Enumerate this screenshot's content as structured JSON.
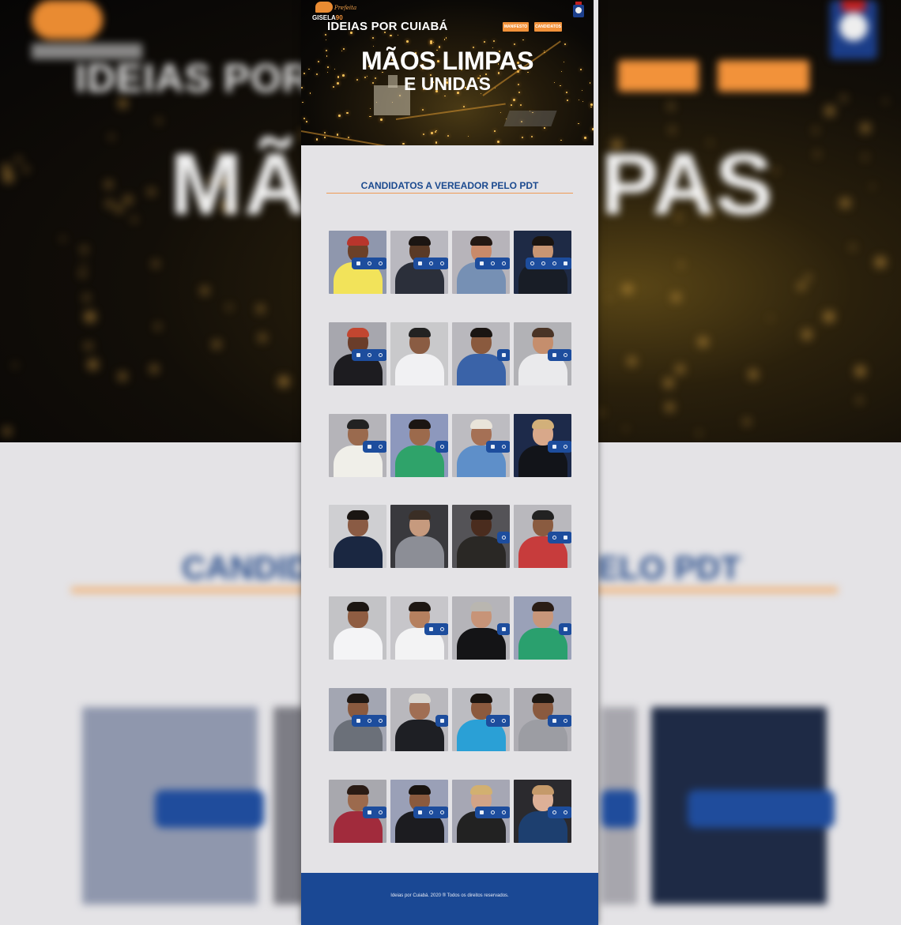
{
  "site": {
    "logo_name": "GISELA90",
    "logo_script": "Prefeita",
    "title": "IDEIAS POR CUIABÁ"
  },
  "nav": {
    "manifesto": "MANIFESTO",
    "candidatos": "CANDIDATOS"
  },
  "hero": {
    "line1": "MÃOS LIMPAS",
    "line2": "E UNIDAS"
  },
  "section": {
    "title": "CANDIDATOS A VEREADOR PELO PDT"
  },
  "candidates": [
    {
      "row": 0,
      "col": 0,
      "bg": "#8f97ad",
      "skin": "#6b4028",
      "outfit": "#f2e35a",
      "hair": "#b8352c",
      "icons": [
        "facebook-icon",
        "instagram-icon",
        "whatsapp-icon"
      ]
    },
    {
      "row": 0,
      "col": 1,
      "bg": "#b9b8bf",
      "skin": "#5a3a26",
      "outfit": "#2b2f3a",
      "hair": "#1b1512",
      "icons": [
        "facebook-icon",
        "instagram-icon",
        "whatsapp-icon"
      ]
    },
    {
      "row": 0,
      "col": 2,
      "bg": "#b7b4ba",
      "skin": "#c98a6a",
      "outfit": "#7690b4",
      "hair": "#231813",
      "icons": [
        "facebook-icon",
        "instagram-icon",
        "whatsapp-icon"
      ]
    },
    {
      "row": 0,
      "col": 3,
      "bg": "#1e2a45",
      "skin": "#c79573",
      "outfit": "#181d26",
      "hair": "#1a1410",
      "icons": [
        "instagram-icon",
        "twitter-icon",
        "whatsapp-icon",
        "facebook-icon"
      ]
    },
    {
      "row": 1,
      "col": 0,
      "bg": "#a7a7ae",
      "skin": "#6a3d2a",
      "outfit": "#1d1c20",
      "hair": "#c24630",
      "icons": [
        "facebook-icon",
        "instagram-icon",
        "whatsapp-icon"
      ]
    },
    {
      "row": 1,
      "col": 1,
      "bg": "#c9c9cb",
      "skin": "#8a5c43",
      "outfit": "#f1f1f3",
      "hair": "#222",
      "icons": []
    },
    {
      "row": 1,
      "col": 2,
      "bg": "#b9b8bd",
      "skin": "#8a5a3e",
      "outfit": "#3a63a8",
      "hair": "#1a1512",
      "icons": [
        "facebook-icon"
      ]
    },
    {
      "row": 1,
      "col": 3,
      "bg": "#b2b2b6",
      "skin": "#c58e6d",
      "outfit": "#eaeaec",
      "hair": "#4a3426",
      "icons": [
        "facebook-icon",
        "instagram-icon"
      ]
    },
    {
      "row": 2,
      "col": 0,
      "bg": "#b5b4b9",
      "skin": "#9a6a4e",
      "outfit": "#f0efe9",
      "hair": "#222",
      "icons": [
        "facebook-icon",
        "instagram-icon"
      ]
    },
    {
      "row": 2,
      "col": 1,
      "bg": "#8d98bd",
      "skin": "#9c6a4c",
      "outfit": "#2fa36a",
      "hair": "#1b1512",
      "icons": [
        "instagram-icon"
      ]
    },
    {
      "row": 2,
      "col": 2,
      "bg": "#bdbcc1",
      "skin": "#a57055",
      "outfit": "#5e8fc9",
      "hair": "#e9e4da",
      "icons": [
        "facebook-icon",
        "instagram-icon"
      ]
    },
    {
      "row": 2,
      "col": 3,
      "bg": "#1d2a4a",
      "skin": "#d8a88a",
      "outfit": "#121419",
      "hair": "#d2b07a",
      "icons": [
        "facebook-icon",
        "instagram-icon"
      ]
    },
    {
      "row": 3,
      "col": 0,
      "bg": "#cfcfd2",
      "skin": "#8a5b44",
      "outfit": "#1a2741",
      "hair": "#1a1512",
      "icons": []
    },
    {
      "row": 3,
      "col": 1,
      "bg": "#39393d",
      "skin": "#c69a7e",
      "outfit": "#8c8e96",
      "hair": "#3a2e25",
      "icons": []
    },
    {
      "row": 3,
      "col": 2,
      "bg": "#545357",
      "skin": "#4a2c1e",
      "outfit": "#2a2825",
      "hair": "#1a1512",
      "icons": [
        "whatsapp-icon"
      ]
    },
    {
      "row": 3,
      "col": 3,
      "bg": "#b9b8bd",
      "skin": "#8a5b40",
      "outfit": "#c73c3c",
      "hair": "#222",
      "icons": [
        "whatsapp-icon",
        "facebook-icon"
      ]
    },
    {
      "row": 4,
      "col": 0,
      "bg": "#c3c3c6",
      "skin": "#8f5d42",
      "outfit": "#f4f4f6",
      "hair": "#1c1612",
      "icons": []
    },
    {
      "row": 4,
      "col": 1,
      "bg": "#c7c6ca",
      "skin": "#b5805f",
      "outfit": "#f3f3f4",
      "hair": "#1e1713",
      "icons": [
        "facebook-icon",
        "instagram-icon"
      ]
    },
    {
      "row": 4,
      "col": 2,
      "bg": "#b5b4b9",
      "skin": "#c79478",
      "outfit": "#141416",
      "hair": "#b9b6b0",
      "icons": [
        "facebook-icon"
      ]
    },
    {
      "row": 4,
      "col": 3,
      "bg": "#9aa1b8",
      "skin": "#c8967a",
      "outfit": "#2aa06e",
      "hair": "#2a1d16",
      "icons": [
        "facebook-icon"
      ]
    },
    {
      "row": 5,
      "col": 0,
      "bg": "#a3a6b2",
      "skin": "#8a5a3f",
      "outfit": "#6b7079",
      "hair": "#1d1713",
      "icons": [
        "facebook-icon",
        "instagram-icon",
        "whatsapp-icon"
      ]
    },
    {
      "row": 5,
      "col": 1,
      "bg": "#b9b8bd",
      "skin": "#a06e53",
      "outfit": "#1e1f24",
      "hair": "#d9d7d2",
      "icons": [
        "facebook-icon"
      ]
    },
    {
      "row": 5,
      "col": 2,
      "bg": "#bcbcc1",
      "skin": "#8c5a3e",
      "outfit": "#2aa0d6",
      "hair": "#1a1410",
      "icons": [
        "instagram-icon",
        "whatsapp-icon"
      ]
    },
    {
      "row": 5,
      "col": 3,
      "bg": "#aeadb3",
      "skin": "#8a5a3f",
      "outfit": "#9c9da3",
      "hair": "#1c1713",
      "icons": [
        "facebook-icon",
        "instagram-icon"
      ]
    },
    {
      "row": 6,
      "col": 0,
      "bg": "#a8a8ae",
      "skin": "#9c6a4d",
      "outfit": "#a12b3c",
      "hair": "#2a1b14",
      "icons": [
        "facebook-icon",
        "instagram-icon"
      ]
    },
    {
      "row": 6,
      "col": 1,
      "bg": "#9aa0b7",
      "skin": "#8a5a3e",
      "outfit": "#1c1c20",
      "hair": "#1a1410",
      "icons": [
        "facebook-icon",
        "instagram-icon",
        "twitter-icon"
      ]
    },
    {
      "row": 6,
      "col": 2,
      "bg": "#a6a7b4",
      "skin": "#d2a487",
      "outfit": "#222",
      "hair": "#d2b070",
      "icons": [
        "facebook-icon",
        "instagram-icon",
        "whatsapp-icon"
      ]
    },
    {
      "row": 6,
      "col": 3,
      "bg": "#2b2a2e",
      "skin": "#ddb097",
      "outfit": "#1d3f6f",
      "hair": "#c59a6a",
      "icons": [
        "instagram-icon",
        "whatsapp-icon"
      ]
    }
  ],
  "footer": {
    "text": "Ideias por Cuiabá. 2020 ® Todos os direitos reservados."
  },
  "colors": {
    "brand_blue": "#1a4894",
    "accent_orange": "#f2923a",
    "page_bg": "#e4e3e6"
  }
}
